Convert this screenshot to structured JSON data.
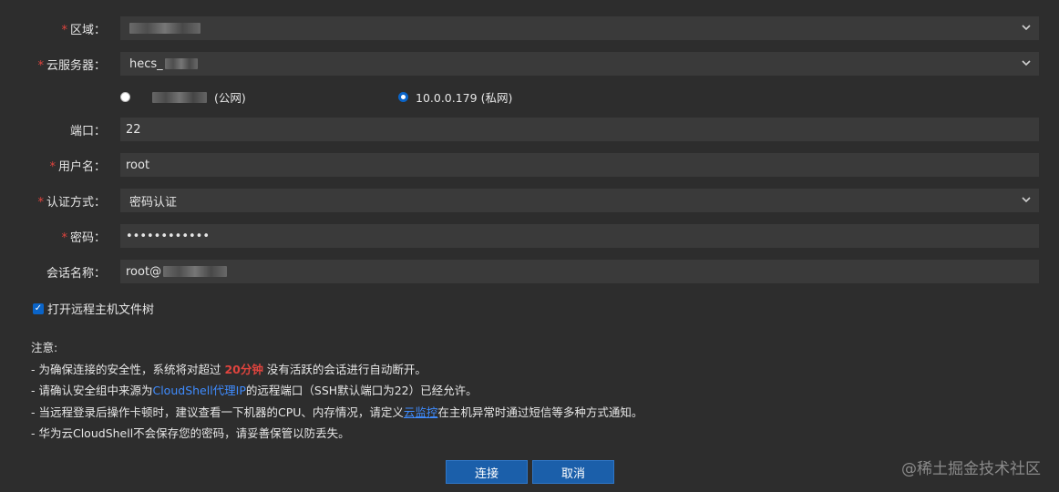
{
  "form": {
    "region": {
      "label": "区域：",
      "required": true,
      "value_blurred": true
    },
    "server": {
      "label": "云服务器：",
      "required": true,
      "value_prefix": "hecs_"
    },
    "ip_options": [
      {
        "suffix": "(公网)",
        "selected": false,
        "blurred": true
      },
      {
        "value": "10.0.0.179 (私网)",
        "selected": true
      }
    ],
    "port": {
      "label": "端口：",
      "value": "22"
    },
    "username": {
      "label": "用户名：",
      "required": true,
      "value": "root"
    },
    "auth": {
      "label": "认证方式：",
      "required": true,
      "value": "密码认证"
    },
    "password": {
      "label": "密码：",
      "required": true,
      "value": "••••••••••••"
    },
    "session": {
      "label": "会话名称：",
      "value_prefix": "root@"
    },
    "filetree": {
      "label": "打开远程主机文件树",
      "checked": true
    }
  },
  "notes": {
    "title": "注意:",
    "line1_a": "- 为确保连接的安全性，系统将对超过",
    "line1_hl": "20分钟",
    "line1_b": "没有活跃的会话进行自动断开。",
    "line2_a": "- 请确认安全组中来源为",
    "line2_link": "CloudShell代理IP",
    "line2_b": "的远程端口（SSH默认端口为22）已经允许。",
    "line3_a": "- 当远程登录后操作卡顿时，建议查看一下机器的CPU、内存情况，请定义",
    "line3_link": "云监控",
    "line3_b": "在主机异常时通过短信等多种方式通知。",
    "line4": "- 华为云CloudShell不会保存您的密码，请妥善保管以防丢失。"
  },
  "buttons": {
    "connect": "连接",
    "cancel": "取消"
  },
  "watermark": "@稀土掘金技术社区",
  "colors": {
    "bg": "#2d2d2d",
    "field": "#3a3a3a",
    "accent": "#1b5faa",
    "required": "#e0443e",
    "link": "#3f8cff"
  }
}
